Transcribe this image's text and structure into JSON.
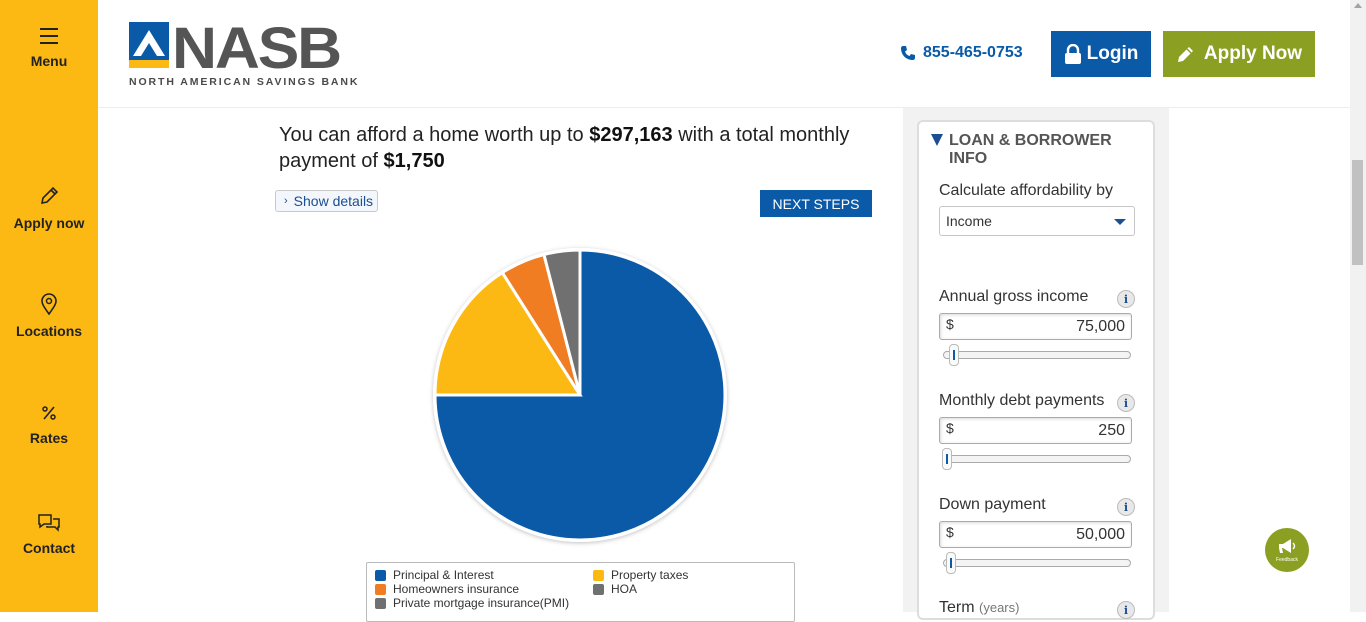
{
  "sidebar": {
    "menu_label": "Menu",
    "apply_label": "Apply now",
    "locations_label": "Locations",
    "rates_label": "Rates",
    "contact_label": "Contact"
  },
  "header": {
    "logo_text": "NASB",
    "logo_subtitle": "NORTH AMERICAN SAVINGS BANK",
    "phone": "855-465-0753",
    "login_label": "Login",
    "apply_label": "Apply Now"
  },
  "result": {
    "prefix": "You can afford a home worth up to ",
    "home_value": "$297,163",
    "middle": " with a total monthly payment of ",
    "monthly_payment": "$1,750"
  },
  "show_details_label": "Show details",
  "next_steps_label": "NEXT STEPS",
  "chart_data": {
    "type": "pie",
    "series": [
      {
        "name": "Principal & Interest",
        "value": 75.0,
        "color": "#0a5aa8"
      },
      {
        "name": "Property taxes",
        "value": 16.0,
        "color": "#fdb913"
      },
      {
        "name": "Homeowners insurance",
        "value": 5.0,
        "color": "#f07d22"
      },
      {
        "name": "HOA",
        "value": 4.0,
        "color": "#707070"
      }
    ],
    "legend": [
      {
        "name": "Principal & Interest",
        "color": "#0a5aa8"
      },
      {
        "name": "Property taxes",
        "color": "#fdb913"
      },
      {
        "name": "Homeowners insurance",
        "color": "#f07d22"
      },
      {
        "name": "HOA",
        "color": "#707070"
      },
      {
        "name": "Private mortgage insurance(PMI)",
        "color": "#707070"
      }
    ],
    "legend_position": "bottom"
  },
  "panel": {
    "title": "LOAN & BORROWER INFO",
    "calc_label": "Calculate affordability by",
    "calc_value": "Income",
    "income_label": "Annual gross income",
    "income_currency": "$",
    "income_value": "75,000",
    "income_slider_fraction": 0.04,
    "debt_label": "Monthly debt payments",
    "debt_currency": "$",
    "debt_value": "250",
    "debt_slider_fraction": 0.0,
    "down_label": "Down payment",
    "down_currency": "$",
    "down_value": "50,000",
    "down_slider_fraction": 0.02,
    "term_label": "Term",
    "term_unit": "(years)",
    "info_glyph": "i"
  },
  "feedback_label": "Feedback",
  "colors": {
    "sidebar": "#fdb913",
    "primary_blue": "#0a5aa8",
    "apply_green": "#8ba022"
  }
}
